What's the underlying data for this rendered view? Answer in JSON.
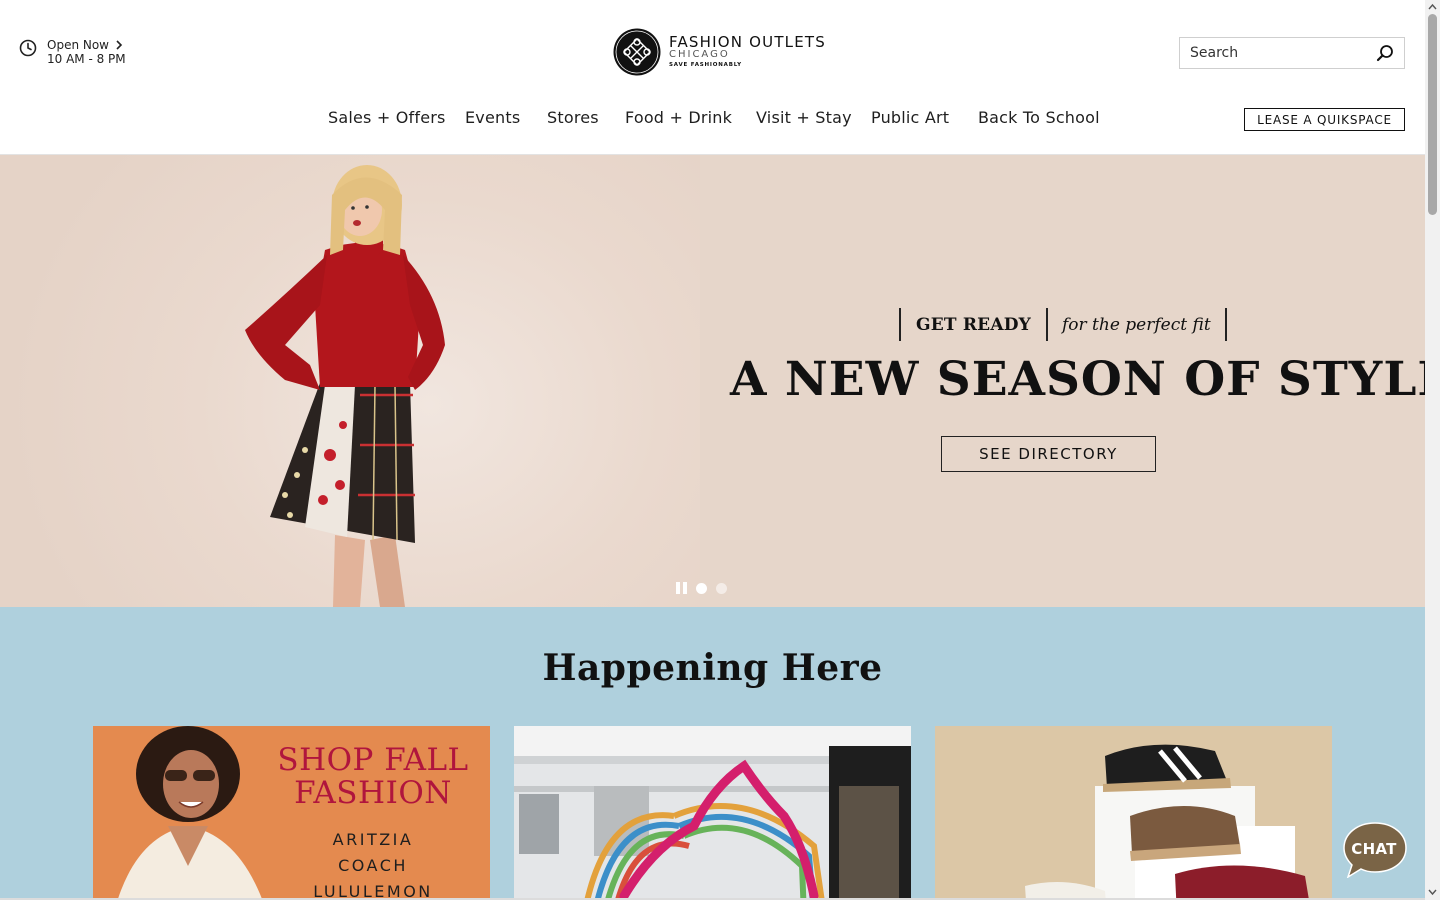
{
  "header": {
    "hours": {
      "status": "Open Now",
      "times": "10 AM - 8 PM"
    },
    "logo": {
      "name": "FASHION OUTLETS",
      "city": "CHICAGO",
      "tagline": "SAVE FASHIONABLY"
    },
    "search": {
      "placeholder": "Search"
    },
    "nav": [
      "Sales + Offers",
      "Events",
      "Stores",
      "Food + Drink",
      "Visit + Stay",
      "Public Art",
      "Back To School"
    ],
    "lease_button": "LEASE A QUIKSPACE"
  },
  "hero": {
    "kicker_left": "GET READY",
    "kicker_right": "for the perfect fit",
    "headline": "A NEW SEASON OF STYLE",
    "cta": "SEE DIRECTORY",
    "slides": {
      "count": 2,
      "active": 1
    }
  },
  "happening": {
    "title": "Happening Here",
    "card1": {
      "headline_line1": "SHOP FALL",
      "headline_line2": "FASHION",
      "brands": [
        "ARITZIA",
        "COACH",
        "LULULEMON"
      ]
    }
  },
  "chat": {
    "label": "CHAT"
  },
  "colors": {
    "hero_bg": "#e6d6ca",
    "happening_bg": "#afd0dd",
    "card1_bg": "#e48a4f",
    "card1_headline": "#b0153d"
  }
}
